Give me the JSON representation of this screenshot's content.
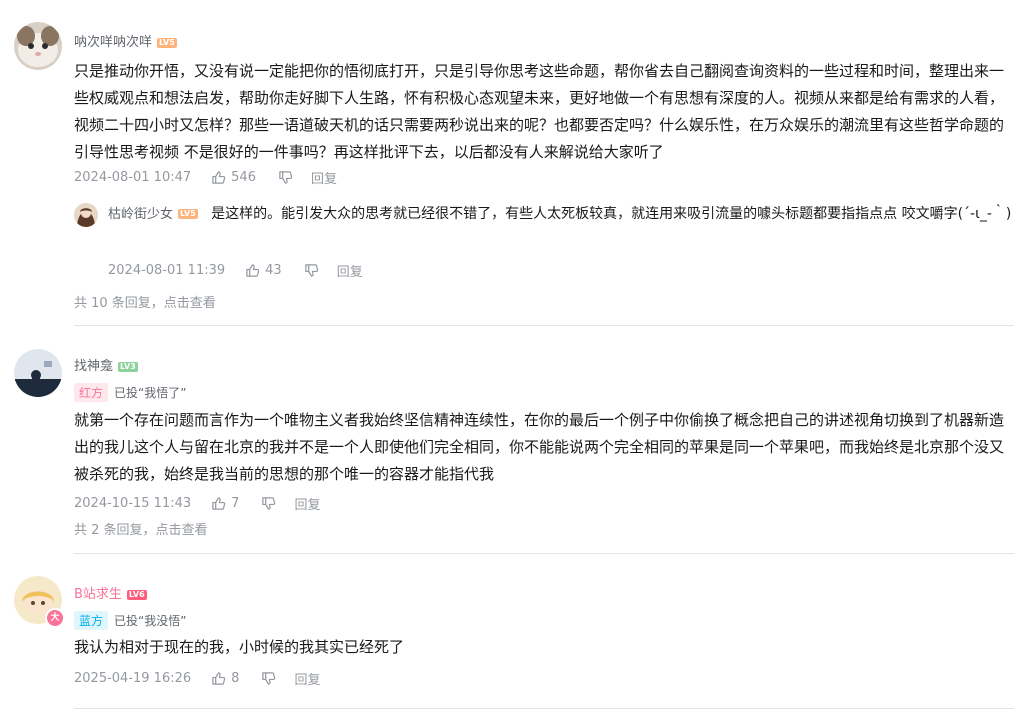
{
  "comments": [
    {
      "username": "呐次咩呐次咩",
      "level": "LV5",
      "level_color": "#ffb37c",
      "text": "只是推动你开悟，又没有说一定能把你的悟彻底打开，只是引导你思考这些命题，帮你省去自己翻阅查询资料的一些过程和时间，整理出来一些权威观点和想法启发，帮助你走好脚下人生路，怀有积极心态观望未来，更好地做一个有思想有深度的人。视频从来都是给有需求的人看，视频二十四小时又怎样？那些一语道破天机的话只需要两秒说出来的呢？也都要否定吗？什么娱乐性，在万众娱乐的潮流里有这些哲学命题的引导性思考视频 不是很好的一件事吗？再这样批评下去，以后都没有人来解说给大家听了",
      "time": "2024-08-01 10:47",
      "likes": "546",
      "reply_label": "回复",
      "reply": {
        "username": "枯岭街少女",
        "level": "LV5",
        "level_color": "#ffb37c",
        "text": "是这样的。能引发大众的思考就已经很不错了，有些人太死板较真，就连用来吸引流量的噱头标题都要指指点点 咬文嚼字(´-ι_-｀)",
        "time": "2024-08-01 11:39",
        "likes": "43",
        "reply_label": "回复"
      },
      "more_replies": "共 10 条回复，点击查看"
    },
    {
      "username": "找神龛",
      "level": "LV3",
      "level_color": "#8bd29b",
      "vote_tag": "红方",
      "vote_text": "已投“我悟了”",
      "text": "就第一个存在问题而言作为一个唯物主义者我始终坚信精神连续性，在你的最后一个例子中你偷换了概念把自己的讲述视角切换到了机器新造出的我儿这个人与留在北京的我并不是一个人即使他们完全相同，你不能能说两个完全相同的苹果是同一个苹果吧，而我始终是北京那个没又被杀死的我，始终是我当前的思想的那个唯一的容器才能指代我",
      "time": "2024-10-15 11:43",
      "likes": "7",
      "reply_label": "回复",
      "more_replies": "共 2 条回复，点击查看"
    },
    {
      "username": "B站求生",
      "level": "LV6",
      "level_color": "#ff5c7c",
      "badge": "大",
      "vote_tag": "蓝方",
      "vote_text": "已投“我没悟”",
      "text": "我认为相对于现在的我，小时候的我其实已经死了",
      "time": "2025-04-19 16:26",
      "likes": "8",
      "reply_label": "回复"
    }
  ],
  "colors": {
    "accent_pink": "#fb7299",
    "accent_blue": "#00aeec",
    "meta_gray": "#9499a0",
    "divider": "#e3e5e7"
  }
}
